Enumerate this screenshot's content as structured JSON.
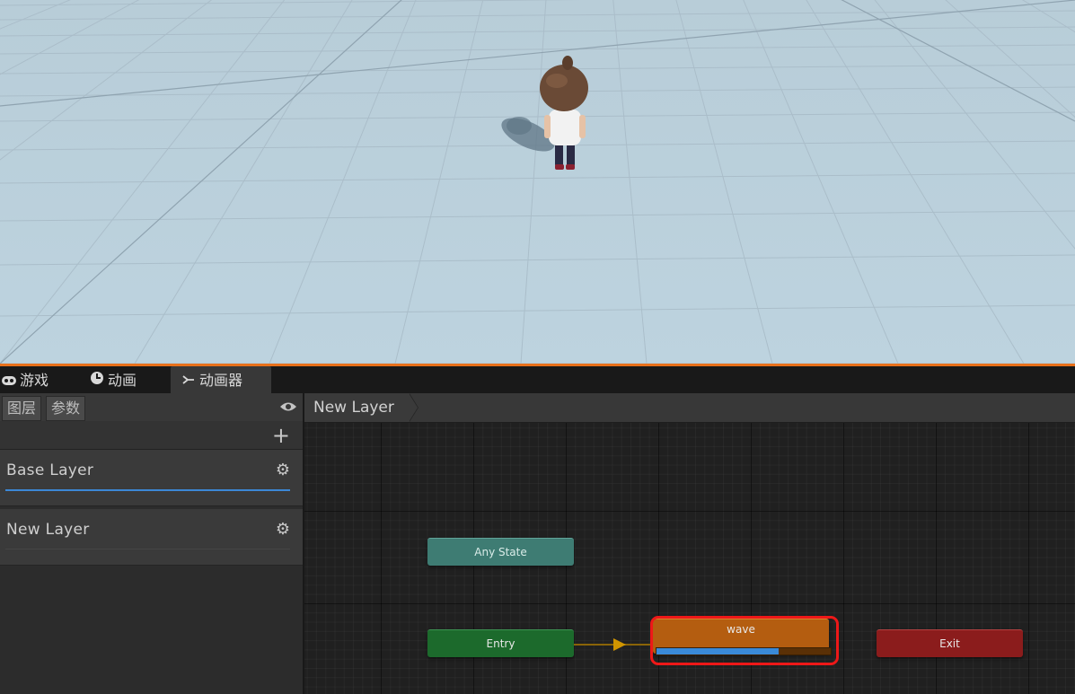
{
  "tabs": [
    {
      "label": "游戏",
      "icon": "gamepad-icon",
      "active": false
    },
    {
      "label": "动画",
      "icon": "clock-icon",
      "active": false
    },
    {
      "label": "动画器",
      "icon": "animator-icon",
      "active": true
    }
  ],
  "left_panel": {
    "subtabs": [
      "图层",
      "参数"
    ],
    "layers": [
      {
        "name": "Base Layer",
        "selected": true
      },
      {
        "name": "New Layer",
        "selected": false
      }
    ]
  },
  "graph": {
    "breadcrumb": "New Layer",
    "nodes": {
      "any_state": "Any State",
      "entry": "Entry",
      "wave": "wave",
      "exit": "Exit"
    },
    "wave_progress": 0.7
  },
  "colors": {
    "accent_orange": "#e8701a",
    "any_state": "#3e7c73",
    "entry": "#1c6a2c",
    "exit": "#8b1c1c",
    "active_state": "#b45d10",
    "highlight": "#ee1818",
    "progress": "#3a8ad8"
  }
}
